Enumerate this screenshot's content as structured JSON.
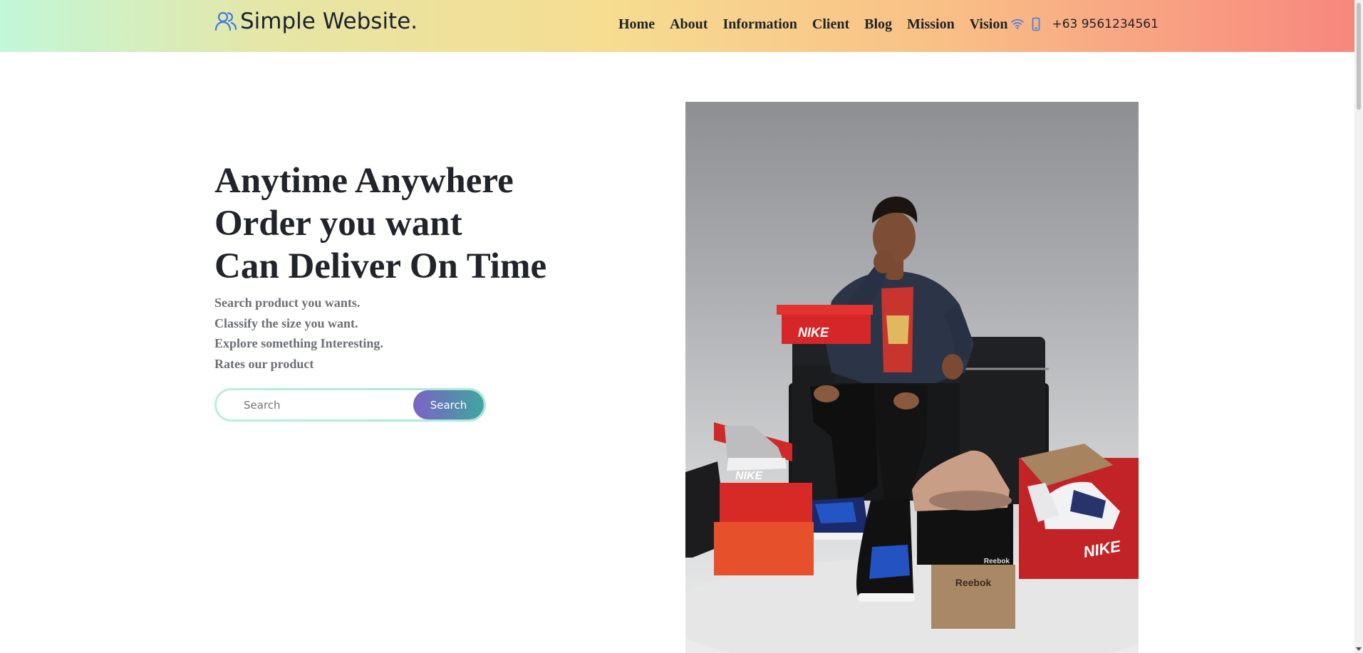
{
  "header": {
    "brand_icon": "users-icon",
    "brand_name": "Simple Website.",
    "nav": [
      "Home",
      "About",
      "Information",
      "Client",
      "Blog",
      "Mission",
      "Vision"
    ],
    "wifi_icon": "wifi-icon",
    "phone_icon": "phone-icon",
    "phone_number": "+63 9561234561"
  },
  "hero": {
    "title_lines": [
      "Anytime Anywhere",
      "Order you want",
      "Can Deliver On Time"
    ],
    "features": [
      "Search product you wants.",
      "Classify the size you want.",
      "Explore something Interesting.",
      "Rates our product"
    ],
    "search_placeholder": "Search",
    "search_button": "Search"
  },
  "colors": {
    "accent_purple": "#7a63c4",
    "accent_teal": "#3fa6a0",
    "header_gradient_start": "#c2f7d8",
    "header_gradient_end": "#f7877e",
    "brand_icon_blue": "#3d7be8"
  }
}
